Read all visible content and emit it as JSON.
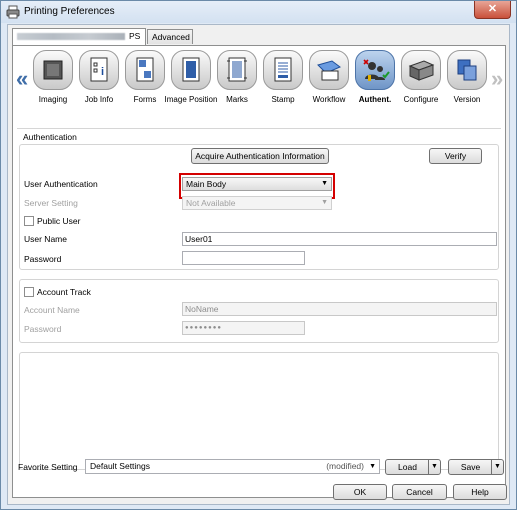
{
  "window": {
    "title": "Printing Preferences",
    "close_symbol": "✕"
  },
  "tabs": [
    {
      "label": "PS",
      "active": true
    },
    {
      "label": "Advanced",
      "active": false
    }
  ],
  "toolbar": {
    "prev_arrow": "«",
    "next_arrow": "»",
    "items": [
      {
        "label": "Imaging",
        "icon": "imaging-icon"
      },
      {
        "label": "Job Info",
        "icon": "job-info-icon"
      },
      {
        "label": "Forms",
        "icon": "forms-icon"
      },
      {
        "label": "Image Position",
        "icon": "image-position-icon"
      },
      {
        "label": "Marks",
        "icon": "marks-icon"
      },
      {
        "label": "Stamp",
        "icon": "stamp-icon"
      },
      {
        "label": "Workflow",
        "icon": "workflow-icon"
      },
      {
        "label": "Authent.",
        "icon": "authentication-icon"
      },
      {
        "label": "Configure",
        "icon": "configure-icon"
      },
      {
        "label": "Version",
        "icon": "version-icon"
      }
    ]
  },
  "authentication": {
    "section_title": "Authentication",
    "acquire_button": "Acquire Authentication Information",
    "verify_button": "Verify",
    "user_auth_label": "User Authentication",
    "user_auth_value": "Main Body",
    "server_setting_label": "Server Setting",
    "server_setting_value": "Not Available",
    "public_user_label": "Public User",
    "user_name_label": "User Name",
    "user_name_value": "User01",
    "password_label": "Password",
    "password_value": ""
  },
  "account_track": {
    "checkbox_label": "Account Track",
    "account_name_label": "Account Name",
    "account_name_value": "NoName",
    "password_label": "Password",
    "password_value": "●●●●●●●●"
  },
  "favorite": {
    "label": "Favorite Setting",
    "value": "Default Settings",
    "modified": "(modified)",
    "load_button": "Load",
    "save_button": "Save"
  },
  "dialog_buttons": {
    "ok": "OK",
    "cancel": "Cancel",
    "help": "Help"
  },
  "colors": {
    "highlight": "#d40000",
    "accent": "#3f6ea8"
  }
}
